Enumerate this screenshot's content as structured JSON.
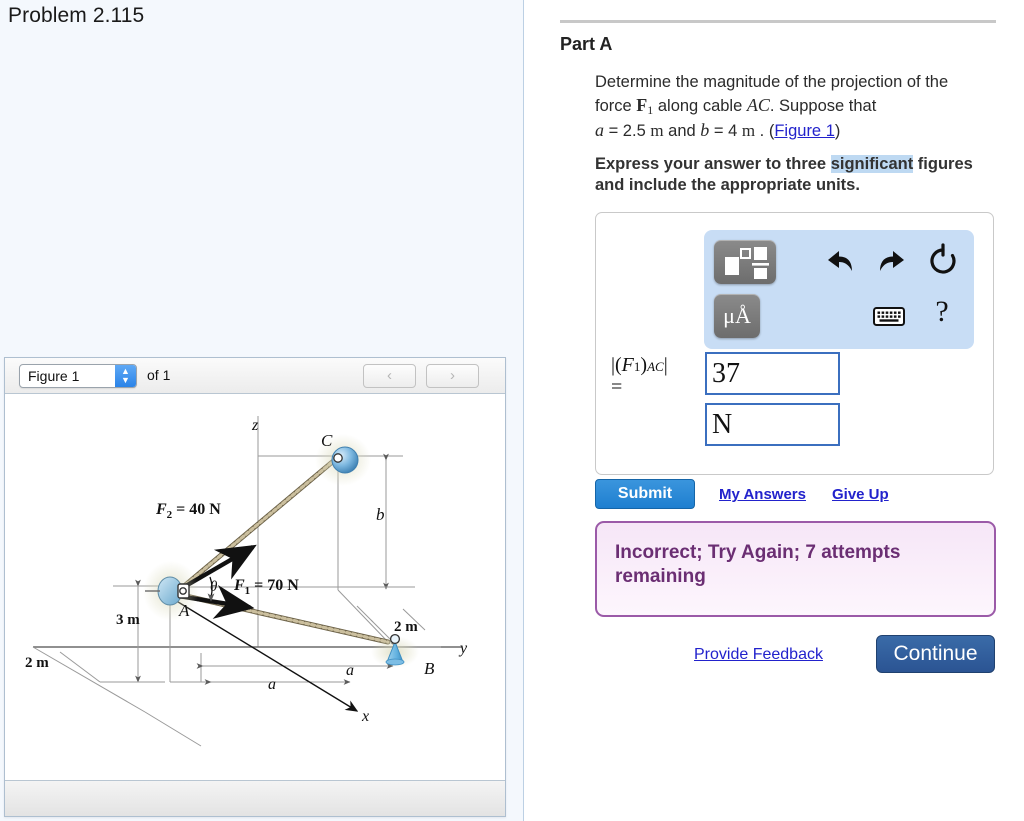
{
  "left": {
    "problem_title": "Problem 2.115",
    "figure_panel": {
      "select_value": "Figure 1",
      "of_label": "of 1",
      "prev_label": "‹",
      "next_label": "›"
    }
  },
  "right": {
    "part_label": "Part A",
    "question": {
      "line1": "Determine the magnitude of the projection of the",
      "line2_pre": "force ",
      "force_symbol": "F",
      "force_sub": "1",
      "line2_mid": " along cable ",
      "cable_symbol": "AC",
      "line2_post": ". Suppose that",
      "a_symbol": "a",
      "a_eq": " = 2.5",
      "a_unit": "m",
      "and_text": " and ",
      "b_symbol": "b",
      "b_eq": " = 4",
      "b_unit": "m",
      "period": " . (",
      "figure_link": "Figure 1",
      "close_paren": ")"
    },
    "express_note": {
      "pre": "Express your answer to three ",
      "highlight": "significant",
      "post": " figures and include the appropriate units."
    },
    "answer": {
      "label_math": "|(F₁)",
      "label_sub": "AC",
      "label_bar": "|",
      "label_eq": "=",
      "value": "37",
      "units": "N",
      "value_placeholder": "",
      "units_placeholder": ""
    },
    "mathpad": {
      "units_button_label": "μÅ",
      "help_label": "?",
      "template_name": "template-button",
      "undo_name": "undo-button",
      "redo_name": "redo-button",
      "reset_name": "reset-button",
      "keyboard_name": "keyboard-button"
    },
    "buttons": {
      "submit": "Submit",
      "my_answers": "My Answers",
      "give_up": "Give Up",
      "provide_feedback": "Provide Feedback",
      "continue": "Continue"
    },
    "feedback": {
      "text": "Incorrect; Try Again; 7 attempts remaining"
    }
  },
  "figure": {
    "labels": {
      "axis_z": "z",
      "axis_y": "y",
      "axis_x": "x",
      "point_a": "A",
      "point_b": "B",
      "point_c": "C",
      "theta": "θ",
      "f2": "F",
      "f2_sub": "2",
      "f2_val": "= 40 N",
      "f1": "F",
      "f1_sub": "1",
      "f1_val": "= 70 N",
      "dim_b": "b",
      "dim_a_right": "a",
      "dim_a_bottom": "a",
      "dim_2m_right": "2 m",
      "dim_3m": "3 m",
      "dim_2m_left": "2 m"
    }
  },
  "colors": {
    "accent_blue": "#1f7fd0",
    "continue_blue": "#2b5493",
    "feedback_border": "#9b5aa8",
    "feedback_text": "#6b2e73",
    "link_blue": "#2222cc",
    "highlight": "#bed9f2",
    "mathpad_bg": "#c8ddf5",
    "left_bg": "#f4f8fd"
  }
}
